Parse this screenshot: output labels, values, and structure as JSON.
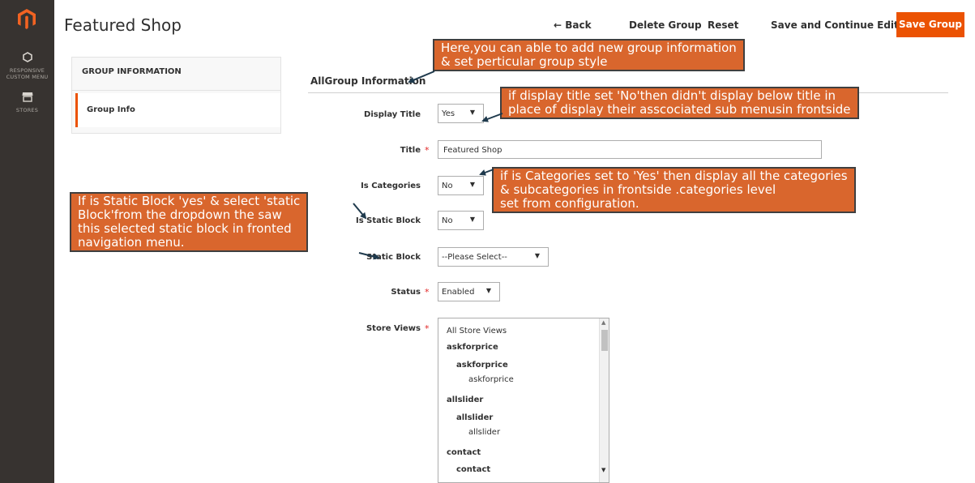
{
  "sidebar": {
    "menu_label_line1": "RESPONSIVE",
    "menu_label_line2": "CUSTOM MENU",
    "stores_label": "STORES"
  },
  "header": {
    "title": "Featured Shop",
    "back": "← Back",
    "delete": "Delete Group",
    "reset": "Reset",
    "save_continue": "Save and Continue Edit",
    "save_group": "Save Group"
  },
  "tabs": {
    "title": "GROUP INFORMATION",
    "item": "Group Info"
  },
  "form": {
    "section_title": "AllGroup Information",
    "display_title": {
      "label": "Display Title",
      "value": "Yes"
    },
    "title": {
      "label": "Title",
      "value": "Featured Shop"
    },
    "is_categories": {
      "label": "Is Categories",
      "value": "No"
    },
    "is_static_block": {
      "label": "Is Static Block",
      "value": "No"
    },
    "static_block": {
      "label": "Static Block",
      "value": "--Please Select--"
    },
    "status": {
      "label": "Status",
      "value": "Enabled"
    },
    "store_views": {
      "label": "Store Views",
      "options": [
        "All Store Views",
        "askforprice",
        "askforprice",
        "askforprice",
        "allslider",
        "allslider",
        "allslider",
        "contact",
        "contact"
      ]
    }
  },
  "notes": {
    "note1_line1": "Here,you can able to  add new group information",
    "note1_line2": "& set perticular group style",
    "note2_line1": "if display title set 'No'then didn't display below title in",
    "note2_line2": "place of display their asscociated sub menusin frontside",
    "note3_line1": "if is Categories set to 'Yes' then display all the categories",
    "note3_line2": "& subcategories in frontside .categories level",
    "note3_line3": "set from configuration.",
    "note4_line1": "If is Static Block 'yes' & select 'static",
    "note4_line2": "Block'from the dropdown the saw",
    "note4_line3": "this selected static block in fronted",
    "note4_line4": "navigation menu."
  },
  "colors": {
    "sidebar": "#373330",
    "accent": "#eb5202",
    "note_fill": "#d9662d",
    "note_border": "#3f3f3f"
  }
}
